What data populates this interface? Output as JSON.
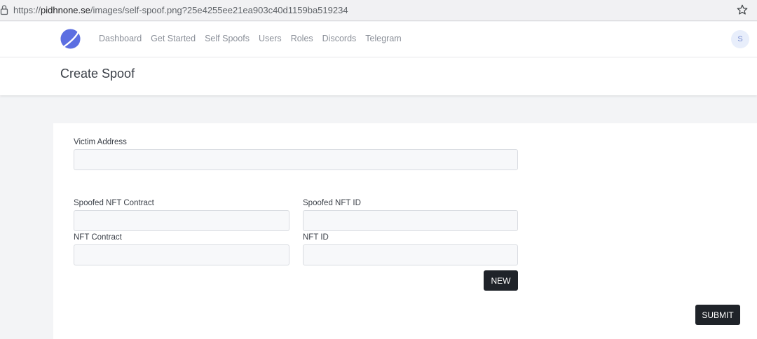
{
  "browser": {
    "url_prefix": "https://",
    "url_host": "pidhnone.se",
    "url_path": "/images/self-spoof.png?25e4255ee21ea903c40d1159ba519234",
    "icons": [
      "lock-icon",
      "star-icon"
    ]
  },
  "header": {
    "logo_icon": "logo-icon",
    "nav": [
      "Dashboard",
      "Get Started",
      "Self Spoofs",
      "Users",
      "Roles",
      "Discords",
      "Telegram"
    ],
    "avatar_initial": "S"
  },
  "page": {
    "title": "Create Spoof"
  },
  "form": {
    "victim_address": {
      "label": "Victim Address",
      "value": ""
    },
    "spoofed_nft_contract": {
      "label": "Spoofed NFT Contract",
      "value": ""
    },
    "spoofed_nft_id": {
      "label": "Spoofed NFT ID",
      "value": ""
    },
    "nft_contract": {
      "label": "NFT Contract",
      "value": ""
    },
    "nft_id": {
      "label": "NFT ID",
      "value": ""
    },
    "new_label": "NEW",
    "submit_label": "SUBMIT"
  },
  "colors": {
    "accent": "#5b6ee1",
    "button": "#1f2329",
    "background": "#f3f4f6"
  }
}
